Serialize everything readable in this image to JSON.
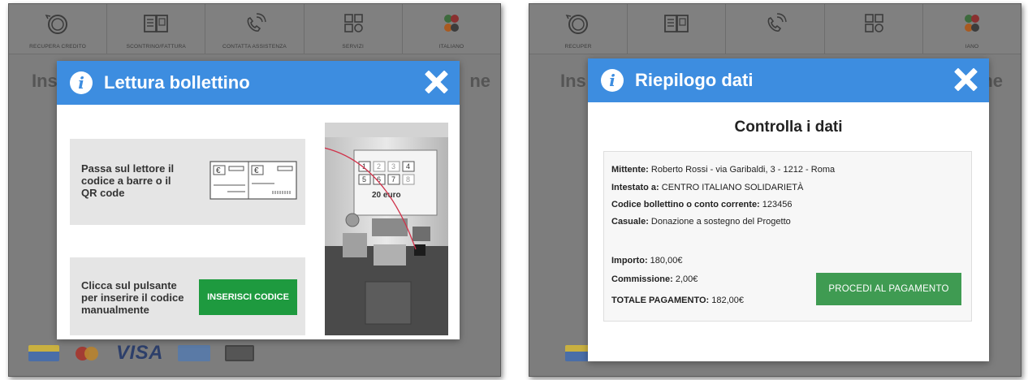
{
  "nav": {
    "items": [
      {
        "label": "RECUPERA CREDITO",
        "icon": "coin-refund-icon"
      },
      {
        "label": "SCONTRINO/FATTURA",
        "icon": "receipt-icon"
      },
      {
        "label": "CONTATTA ASSISTENZA",
        "icon": "phone-icon"
      },
      {
        "label": "SERVIZI",
        "icon": "grid-icon"
      },
      {
        "label": "ITALIANO",
        "icon": "flag-icon"
      }
    ],
    "right_items": [
      {
        "label": "RECUPER"
      },
      {
        "label": ""
      },
      {
        "label": ""
      },
      {
        "label": ""
      },
      {
        "label": "IANO"
      }
    ]
  },
  "background": {
    "left_title_start": "Ins",
    "left_title_end": "ne",
    "payment_logos": [
      "bancomat-pagobancomat",
      "mastercard",
      "VISA",
      "american-express",
      "maestro"
    ],
    "visa_label": "VISA"
  },
  "modal_lettura": {
    "title": "Lettura bollettino",
    "scan_text": "Passa sul lettore il codice a barre o il QR code",
    "manual_text": "Clicca sul pulsante per inserire il codice manualmente",
    "button_label": "INSERISCI CODICE",
    "kiosk_screen_text": "20 euro",
    "kiosk_keys": [
      "1",
      "2",
      "3",
      "4",
      "5",
      "6",
      "7",
      "8"
    ],
    "currency_symbol": "€"
  },
  "modal_riepilogo": {
    "title": "Riepilogo dati",
    "heading": "Controlla i dati",
    "mittente_label": "Mittente:",
    "mittente_value": "Roberto Rossi - via Garibaldi, 3 - 1212 - Roma",
    "intestato_label": "Intestato a:",
    "intestato_value": "CENTRO ITALIANO SOLIDARIETÀ",
    "codice_label": "Codice bollettino o conto corrente:",
    "codice_value": "123456",
    "causale_label": "Casuale:",
    "causale_value": "Donazione a sostegno del Progetto",
    "importo_label": "Importo:",
    "importo_value": "180,00€",
    "commissione_label": "Commissione:",
    "commissione_value": "2,00€",
    "totale_label": "TOTALE PAGAMENTO:",
    "totale_value": "182,00€",
    "button_label": "PROCEDI AL PAGAMENTO"
  },
  "colors": {
    "header_blue": "#3d8de0",
    "button_green": "#1e9a3f",
    "procedi_green": "#3f9b52",
    "overlay_gray": "#7d7d7d"
  }
}
